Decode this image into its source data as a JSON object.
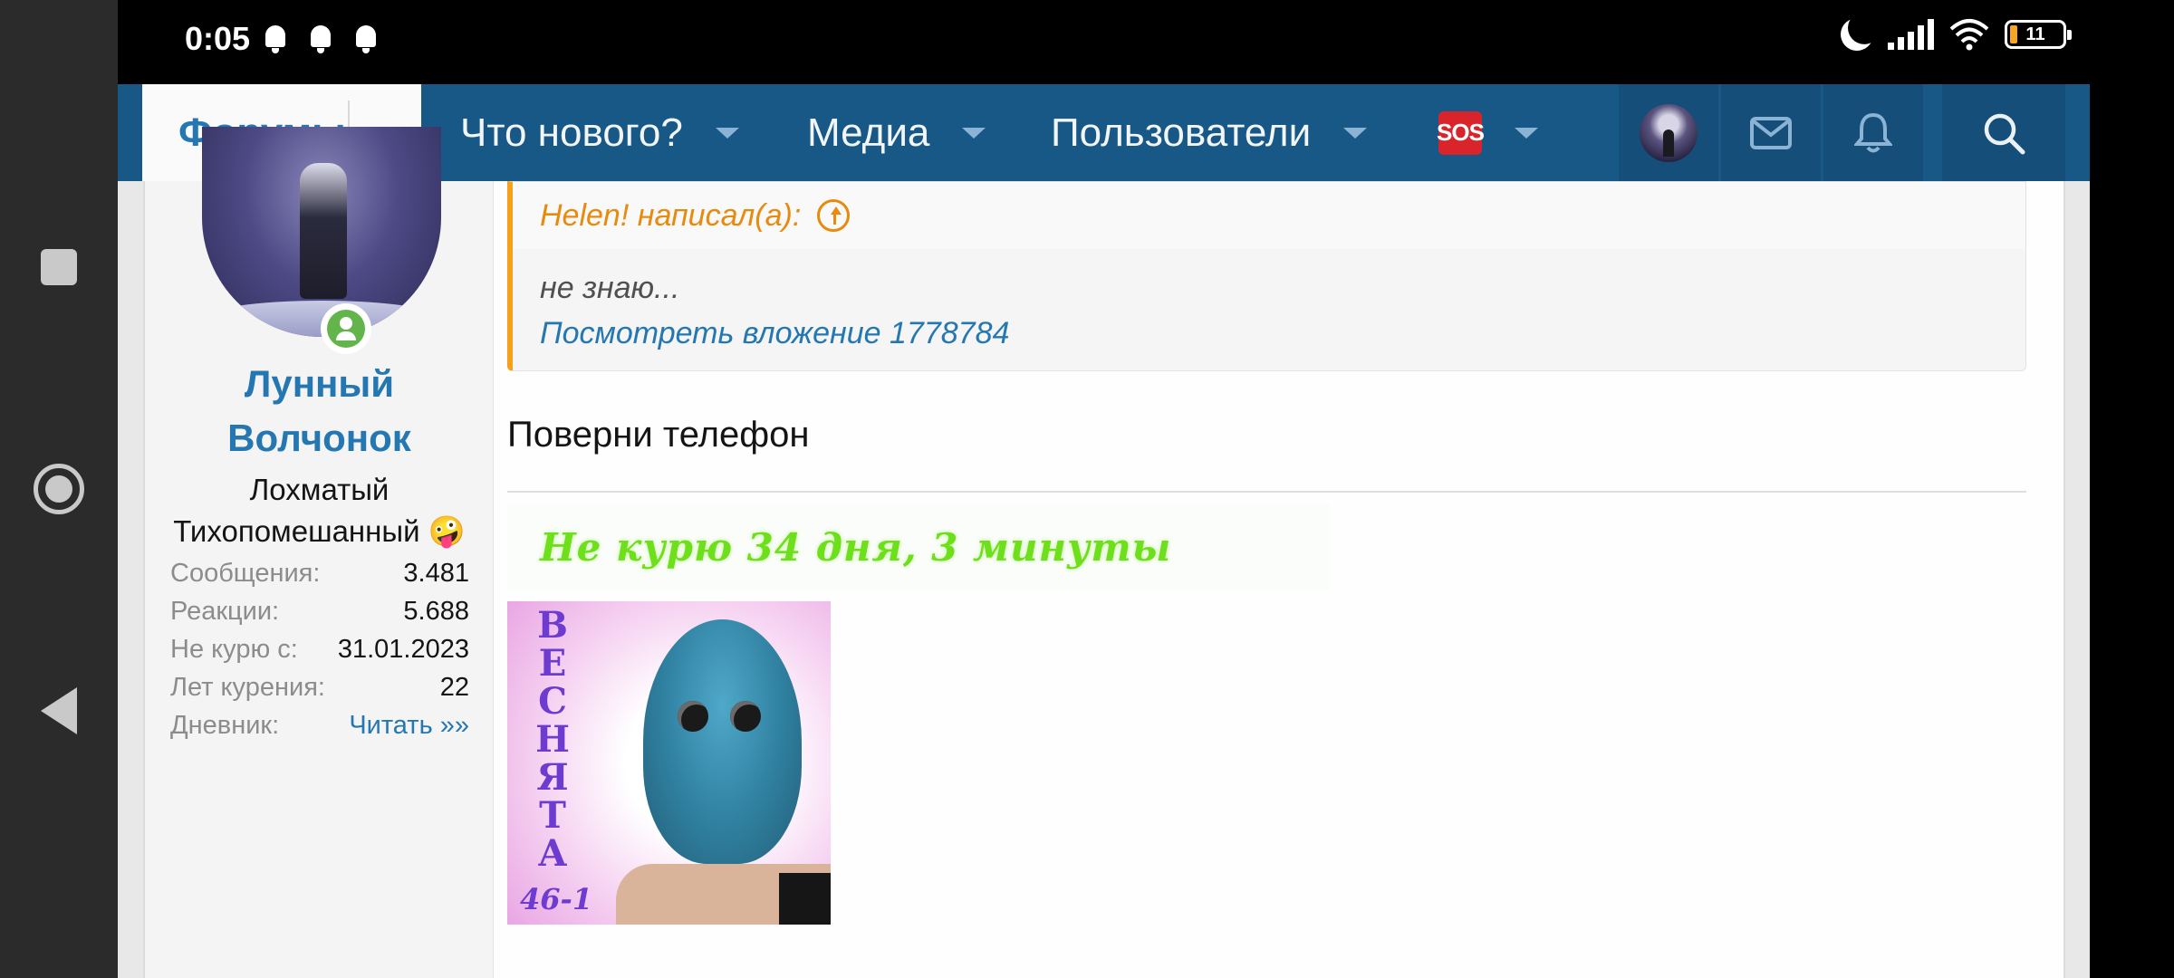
{
  "status_bar": {
    "time": "0:05",
    "battery": "11"
  },
  "header": {
    "nav_items": [
      {
        "label": "Форумы",
        "active": true
      },
      {
        "label": "Что нового?"
      },
      {
        "label": "Медиа"
      },
      {
        "label": "Пользователи"
      },
      {
        "label": "SOS",
        "icon": "sos-icon"
      }
    ],
    "buttons": [
      "avatar-button",
      "inbox-icon",
      "bell-icon",
      "search-icon"
    ]
  },
  "user": {
    "name_line1": "Лунный",
    "name_line2": "Волчонок",
    "title_line1": "Лохматый",
    "title_line2": "Тихопомешанный 🤪",
    "stats": [
      {
        "key": "Сообщения:",
        "value": "3.481"
      },
      {
        "key": "Реакции:",
        "value": "5.688"
      },
      {
        "key": "Не курю с:",
        "value": "31.01.2023"
      },
      {
        "key": "Лет курения:",
        "value": "22"
      },
      {
        "key": "Дневник:",
        "value": "Читать »»"
      }
    ]
  },
  "post": {
    "quote_author": "Helen! написал(а):",
    "quote_text": "не знаю...",
    "quote_link": "Посмотреть вложение 1778784",
    "message": "Поверни телефон",
    "signature_banner": "Не курю  34 дня, 3 минуты",
    "signature_word": [
      "В",
      "Е",
      "С",
      "Н",
      "Я",
      "Т",
      "А"
    ],
    "signature_number": "46-1"
  },
  "colors": {
    "header_bg": "#185886",
    "link": "#2577b1",
    "quote_accent": "#f7a01b",
    "online": "#63b54b"
  }
}
